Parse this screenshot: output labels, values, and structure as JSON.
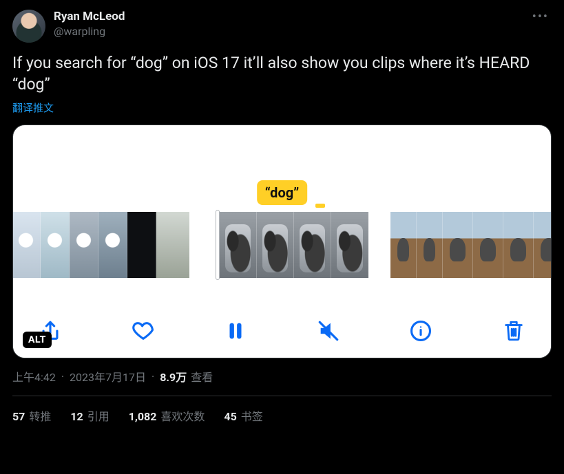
{
  "author": {
    "display_name": "Ryan McLeod",
    "handle": "@warpling"
  },
  "tweet_text": "If you search for “dog” on iOS 17 it’ll also show you clips where it’s HEARD “dog”",
  "translate_label": "翻译推文",
  "media": {
    "tooltip_label": "“dog”",
    "alt_badge": "ALT"
  },
  "meta": {
    "time": "上午4:42",
    "date": "2023年7月17日",
    "views_value": "8.9万",
    "views_label": "查看"
  },
  "stats": {
    "retweets": {
      "count": "57",
      "label": "转推"
    },
    "quotes": {
      "count": "12",
      "label": "引用"
    },
    "likes": {
      "count": "1,082",
      "label": "喜欢次数"
    },
    "bookmarks": {
      "count": "45",
      "label": "书签"
    }
  }
}
